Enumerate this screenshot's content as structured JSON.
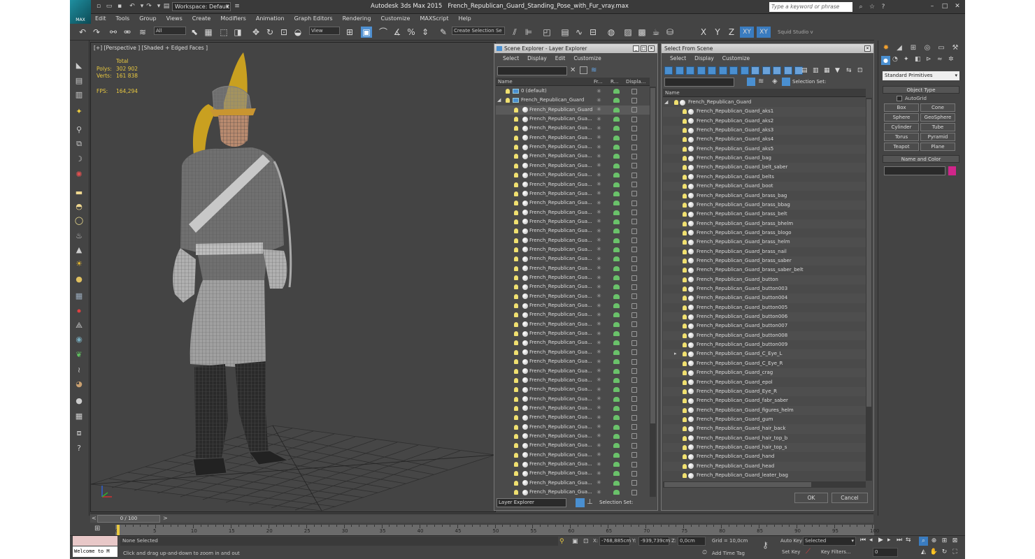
{
  "title": {
    "app": "Autodesk 3ds Max  2015",
    "file": "French_Republican_Guard_Standing_Pose_with_Fur_vray.max",
    "logo": "MAX",
    "workspace": "Workspace: Default",
    "search_placeholder": "Type a keyword or phrase"
  },
  "menu": [
    "Edit",
    "Tools",
    "Group",
    "Views",
    "Create",
    "Modifiers",
    "Animation",
    "Graph Editors",
    "Rendering",
    "Customize",
    "MAXScript",
    "Help"
  ],
  "toolbar": {
    "selection_filter": "All",
    "ref_coord": "View",
    "named_sel": "Create Selection Se",
    "axes": [
      "X",
      "Y",
      "Z",
      "XY",
      "XY"
    ],
    "studio": "Squid Studio v"
  },
  "viewport": {
    "label": "[+] [Perspective ] [Shaded + Edged Faces ]",
    "stats": {
      "total_label": "Total",
      "polys_label": "Polys:",
      "polys": "302 902",
      "verts_label": "Verts:",
      "verts": "161 838",
      "fps_label": "FPS:",
      "fps": "164,294"
    }
  },
  "scene_explorer": {
    "title": "Scene Explorer - Layer Explorer",
    "menu": [
      "Select",
      "Display",
      "Edit",
      "Customize"
    ],
    "columns": [
      "Name",
      "Fr...",
      "R...",
      "Displa..."
    ],
    "rows": [
      {
        "name": "0 (default)",
        "indent": 0,
        "layer": true
      },
      {
        "name": "French_Republican_Guard",
        "indent": 0,
        "layer": true,
        "open": true
      },
      {
        "name": "French_Republican_Guard",
        "indent": 1,
        "group": true
      },
      {
        "name": "French_Republican_Gua...",
        "indent": 1
      },
      {
        "name": "French_Republican_Gua...",
        "indent": 1
      },
      {
        "name": "French_Republican_Gua...",
        "indent": 1
      },
      {
        "name": "French_Republican_Gua...",
        "indent": 1
      },
      {
        "name": "French_Republican_Gua...",
        "indent": 1
      },
      {
        "name": "French_Republican_Gua...",
        "indent": 1
      },
      {
        "name": "French_Republican_Gua...",
        "indent": 1
      },
      {
        "name": "French_Republican_Gua...",
        "indent": 1
      },
      {
        "name": "French_Republican_Gua...",
        "indent": 1
      },
      {
        "name": "French_Republican_Gua...",
        "indent": 1
      },
      {
        "name": "French_Republican_Gua...",
        "indent": 1
      },
      {
        "name": "French_Republican_Gua...",
        "indent": 1
      },
      {
        "name": "French_Republican_Gua...",
        "indent": 1
      },
      {
        "name": "French_Republican_Gua...",
        "indent": 1
      },
      {
        "name": "French_Republican_Gua...",
        "indent": 1
      },
      {
        "name": "French_Republican_Gua...",
        "indent": 1
      },
      {
        "name": "French_Republican_Gua...",
        "indent": 1
      },
      {
        "name": "French_Republican_Gua...",
        "indent": 1
      },
      {
        "name": "French_Republican_Gua...",
        "indent": 1
      },
      {
        "name": "French_Republican_Gua...",
        "indent": 1
      },
      {
        "name": "French_Republican_Gua...",
        "indent": 1
      },
      {
        "name": "French_Republican_Gua...",
        "indent": 1
      },
      {
        "name": "French_Republican_Gua...",
        "indent": 1
      },
      {
        "name": "French_Republican_Gua...",
        "indent": 1
      },
      {
        "name": "French_Republican_Gua...",
        "indent": 1
      },
      {
        "name": "French_Republican_Gua...",
        "indent": 1
      },
      {
        "name": "French_Republican_Gua...",
        "indent": 1
      },
      {
        "name": "French_Republican_Gua...",
        "indent": 1
      },
      {
        "name": "French_Republican_Gua...",
        "indent": 1
      },
      {
        "name": "French_Republican_Gua...",
        "indent": 1
      },
      {
        "name": "French_Republican_Gua...",
        "indent": 1
      },
      {
        "name": "French_Republican_Gua...",
        "indent": 1
      },
      {
        "name": "French_Republican_Gua...",
        "indent": 1
      },
      {
        "name": "French_Republican_Gua...",
        "indent": 1
      },
      {
        "name": "French_Republican_Gua...",
        "indent": 1
      },
      {
        "name": "French_Republican_Gua...",
        "indent": 1
      },
      {
        "name": "French_Republican_Gua...",
        "indent": 1
      },
      {
        "name": "French_Republican_Gua...",
        "indent": 1
      },
      {
        "name": "French_Republican_Gua...",
        "indent": 1
      },
      {
        "name": "French_Republican_Gua...",
        "indent": 1
      },
      {
        "name": "French_Republican_Gua...",
        "indent": 1
      },
      {
        "name": "French_Republican_Gua...",
        "indent": 1
      },
      {
        "name": "French_Republican_Gua...",
        "indent": 1
      },
      {
        "name": "French_Republican_Gua...",
        "indent": 1
      },
      {
        "name": "French_Republican_Gua...",
        "indent": 1
      }
    ],
    "footer_left": "Layer Explorer",
    "footer_right": "Selection Set:"
  },
  "select_from_scene": {
    "title": "Select From Scene",
    "menu": [
      "Select",
      "Display",
      "Customize"
    ],
    "selection_set_label": "Selection Set:",
    "column": "Name",
    "group": "French_Republican_Guard",
    "items": [
      "French_Republican_Guard_aks1",
      "French_Republican_Guard_aks2",
      "French_Republican_Guard_aks3",
      "French_Republican_Guard_aks4",
      "French_Republican_Guard_aks5",
      "French_Republican_Guard_bag",
      "French_Republican_Guard_belt_saber",
      "French_Republican_Guard_belts",
      "French_Republican_Guard_boot",
      "French_Republican_Guard_brass_bag",
      "French_Republican_Guard_brass_bbag",
      "French_Republican_Guard_brass_belt",
      "French_Republican_Guard_brass_bhelm",
      "French_Republican_Guard_brass_blogo",
      "French_Republican_Guard_brass_helm",
      "French_Republican_Guard_brass_nail",
      "French_Republican_Guard_brass_saber",
      "French_Republican_Guard_brass_saber_belt",
      "French_Republican_Guard_button",
      "French_Republican_Guard_button003",
      "French_Republican_Guard_button004",
      "French_Republican_Guard_button005",
      "French_Republican_Guard_button006",
      "French_Republican_Guard_button007",
      "French_Republican_Guard_button008",
      "French_Republican_Guard_button009",
      "French_Republican_Guard_C_Eye_L",
      "French_Republican_Guard_C_Eye_R",
      "French_Republican_Guard_crag",
      "French_Republican_Guard_epol",
      "French_Republican_Guard_Eye_R",
      "French_Republican_Guard_fabr_saber",
      "French_Republican_Guard_figures_helm",
      "French_Republican_Guard_gum",
      "French_Republican_Guard_hair_back",
      "French_Republican_Guard_hair_top_b",
      "French_Republican_Guard_hair_top_s",
      "French_Republican_Guard_hand",
      "French_Republican_Guard_head",
      "French_Republican_Guard_leater_bag"
    ],
    "ok": "OK",
    "cancel": "Cancel"
  },
  "command_panel": {
    "category": "Standard Primitives",
    "object_type": "Object Type",
    "autogrid": "AutoGrid",
    "buttons": [
      "Box",
      "Cone",
      "Sphere",
      "GeoSphere",
      "Cylinder",
      "Tube",
      "Torus",
      "Pyramid",
      "Teapot",
      "Plane"
    ],
    "name_and_color": "Name and Color",
    "swatch_color": "#d0258a"
  },
  "timeline": {
    "frame": "0 / 100",
    "ticks": [
      "0",
      "5",
      "10",
      "15",
      "20",
      "25",
      "30",
      "35",
      "40",
      "45",
      "50",
      "55",
      "60",
      "65",
      "70",
      "75",
      "80",
      "85",
      "90",
      "95",
      "100"
    ]
  },
  "status": {
    "selection": "None Selected",
    "prompt": "Click and drag up-and-down to zoom in and out",
    "listener": "Welcome to M",
    "x_label": "X:",
    "x": "-768,885cm",
    "y_label": "Y:",
    "y": "-939,739cm",
    "z_label": "Z:",
    "z": "0,0cm",
    "grid": "Grid = 10,0cm",
    "add_time_tag": "Add Time Tag",
    "auto_key": "Auto Key",
    "set_key": "Set Key",
    "key_mode": "Selected",
    "key_filters": "Key Filters...",
    "frame_field": "0"
  }
}
